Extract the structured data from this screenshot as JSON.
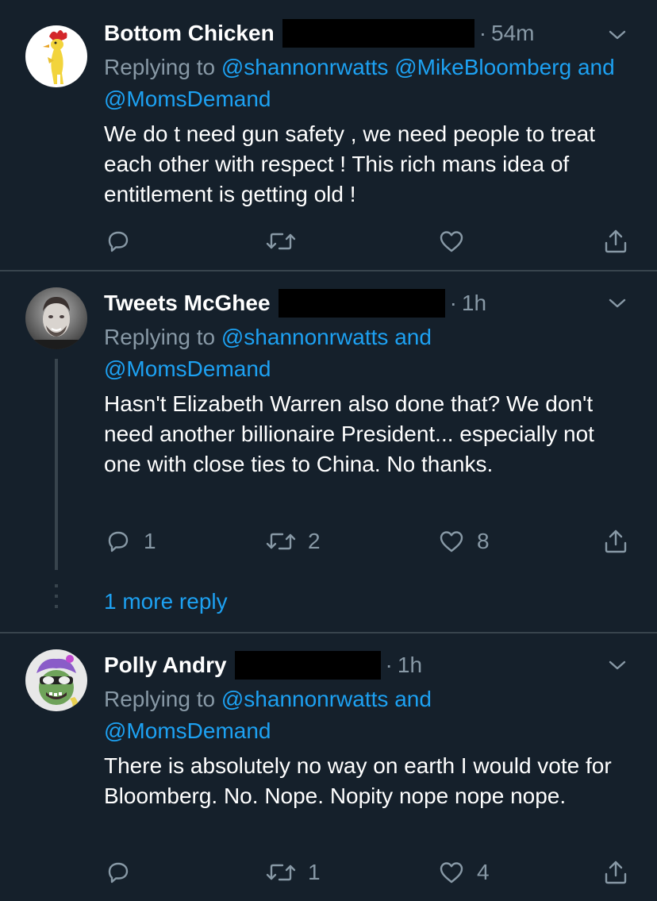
{
  "tweets": [
    {
      "name": "Bottom Chicken",
      "time_sep": "·",
      "time": "54m",
      "replying_prefix": "Replying to",
      "mention_1": "@shannonrwatts",
      "mention_2": "@MikeBloomberg",
      "and_word": "and",
      "mention_3": "@MomsDemand",
      "text": "We do t need gun safety , we need people to treat each other with respect ! This rich mans idea of entitlement is getting old !",
      "reply_count": "",
      "retweet_count": "",
      "like_count": ""
    },
    {
      "name": "Tweets McGhee",
      "time_sep": "·",
      "time": "1h",
      "replying_prefix": "Replying to",
      "mention_1": "@shannonrwatts",
      "and_word": "and",
      "mention_2": "@MomsDemand",
      "text": "Hasn't Elizabeth Warren also done that? We don't need another billionaire President... especially not one with close ties to China. No thanks.",
      "reply_count": "1",
      "retweet_count": "2",
      "like_count": "8",
      "more_replies": "1 more reply"
    },
    {
      "name": "Polly Andry",
      "time_sep": "·",
      "time": "1h",
      "replying_prefix": "Replying to",
      "mention_1": "@shannonrwatts",
      "and_word": "and",
      "mention_2": "@MomsDemand",
      "text": "There is absolutely no way on earth I would vote for Bloomberg. No. Nope. Nopity nope nope nope.",
      "reply_count": "",
      "retweet_count": "1",
      "like_count": "4"
    }
  ],
  "icons": {
    "reply": "reply-icon",
    "retweet": "retweet-icon",
    "like": "heart-icon",
    "share": "share-icon",
    "menu": "chevron-down-icon"
  },
  "colors": {
    "background": "#15202b",
    "divider": "#38444d",
    "secondary_text": "#8899a6",
    "link": "#1da1f2",
    "redaction": "#000000"
  }
}
